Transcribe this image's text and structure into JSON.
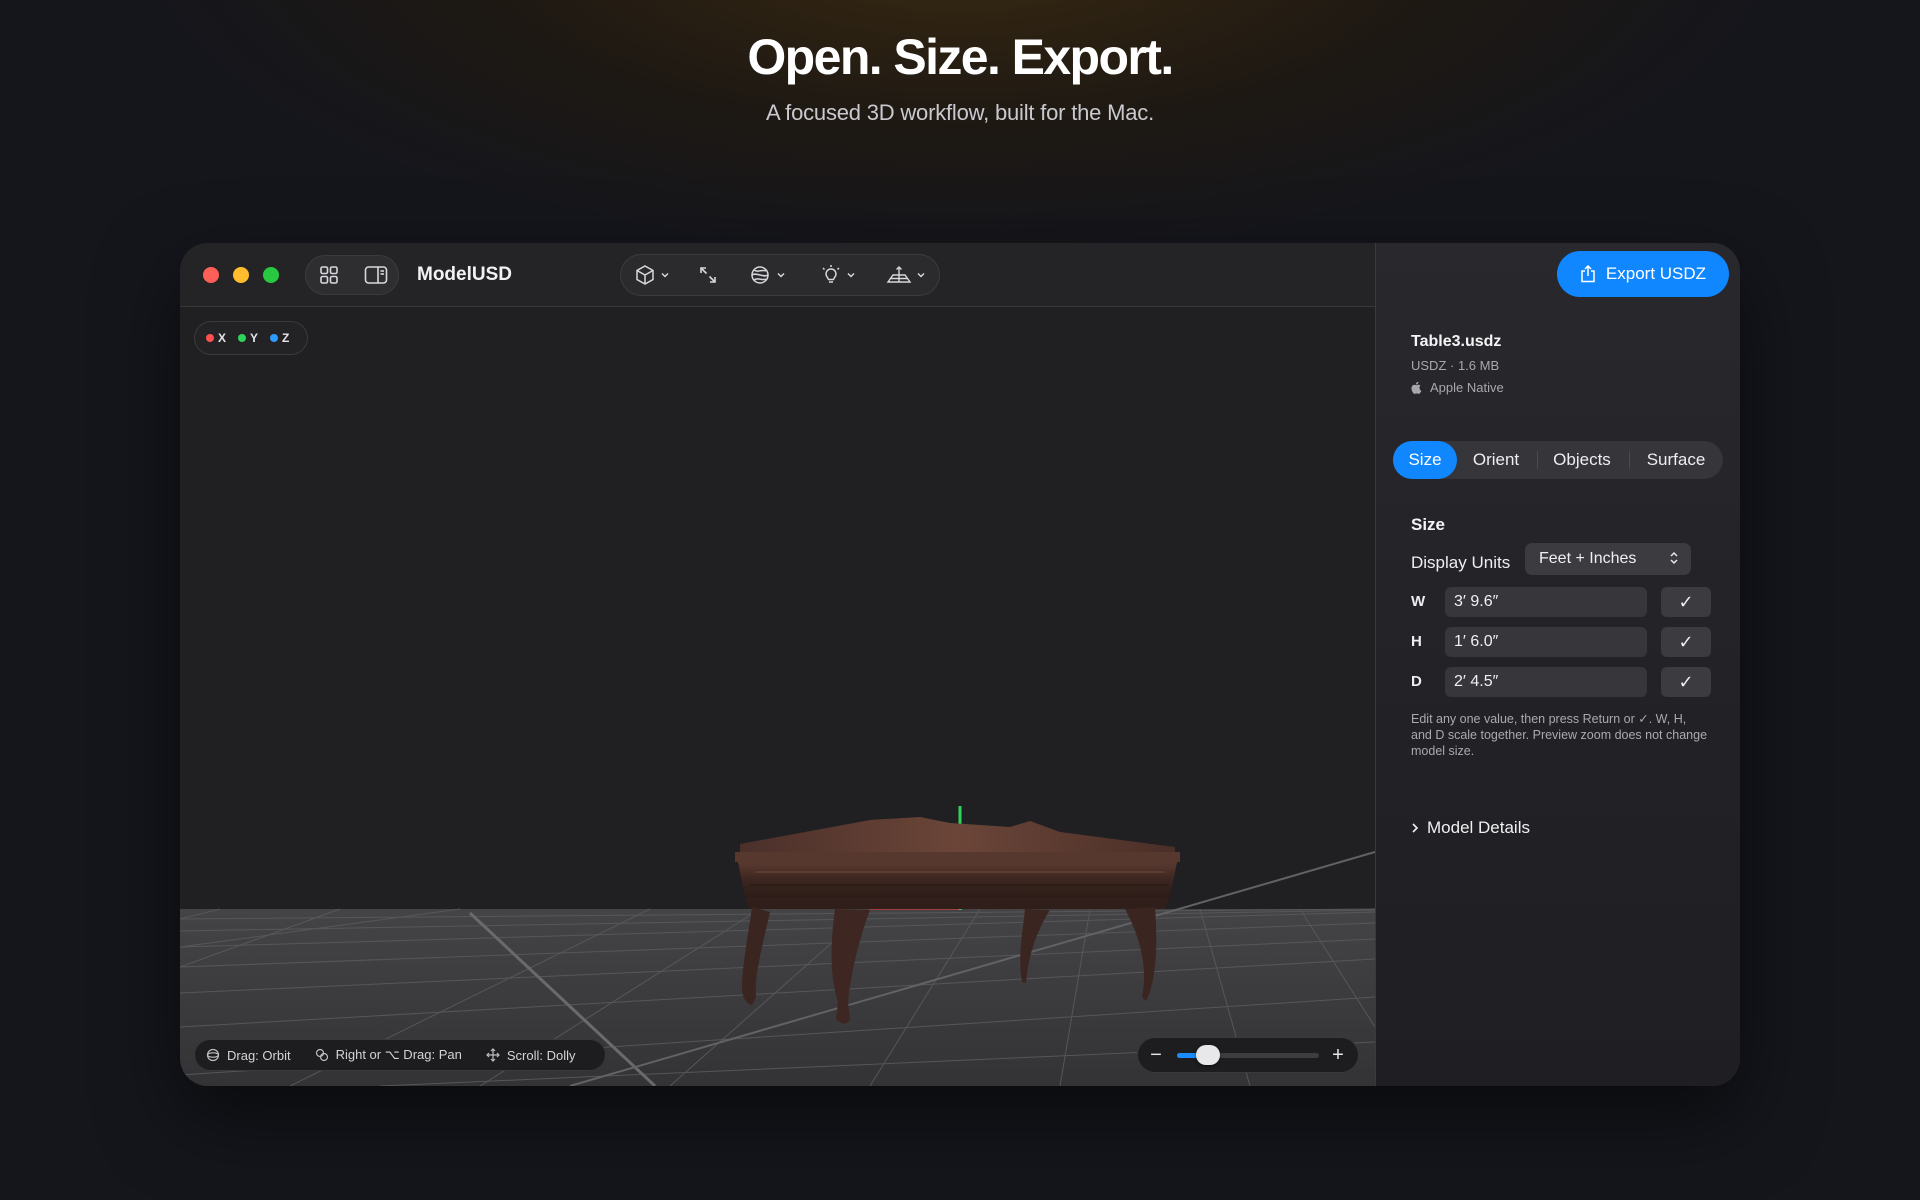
{
  "hero": {
    "title": "Open. Size. Export.",
    "subtitle": "A focused 3D workflow, built for the Mac."
  },
  "window": {
    "app_title": "ModelUSD",
    "toolbar_icons": [
      "grid-icon",
      "sidebar-icon",
      "cube-icon",
      "resize-icon",
      "material-icon",
      "light-icon",
      "floor-grid-icon"
    ]
  },
  "viewport": {
    "axes": [
      {
        "label": "X",
        "color": "#ff4f4f"
      },
      {
        "label": "Y",
        "color": "#2fd35b"
      },
      {
        "label": "Z",
        "color": "#2d9bff"
      }
    ],
    "hints": {
      "orbit": "Drag: Orbit",
      "pan": "Right or ⌥ Drag: Pan",
      "dolly": "Scroll: Dolly"
    },
    "zoom": {
      "minus": "−",
      "plus": "+",
      "level": 0.22
    }
  },
  "inspector": {
    "export_label": "Export USDZ",
    "file": {
      "name": "Table3.usdz",
      "meta": "USDZ · 1.6 MB",
      "native": "Apple Native"
    },
    "tabs": [
      {
        "label": "Size",
        "active": true
      },
      {
        "label": "Orient",
        "active": false
      },
      {
        "label": "Objects",
        "active": false
      },
      {
        "label": "Surface",
        "active": false
      }
    ],
    "size_panel": {
      "title": "Size",
      "units_label": "Display Units",
      "units_value": "Feet + Inches",
      "dims": [
        {
          "label": "W",
          "value": "3′ 9.6″"
        },
        {
          "label": "H",
          "value": "1′ 6.0″"
        },
        {
          "label": "D",
          "value": "2′ 4.5″"
        }
      ],
      "confirm_glyph": "✓",
      "help": "Edit any one value, then press Return or ✓. W, H, and D scale together. Preview zoom does not change model size."
    },
    "details_label": "Model Details",
    "accent": "#1187ff"
  }
}
